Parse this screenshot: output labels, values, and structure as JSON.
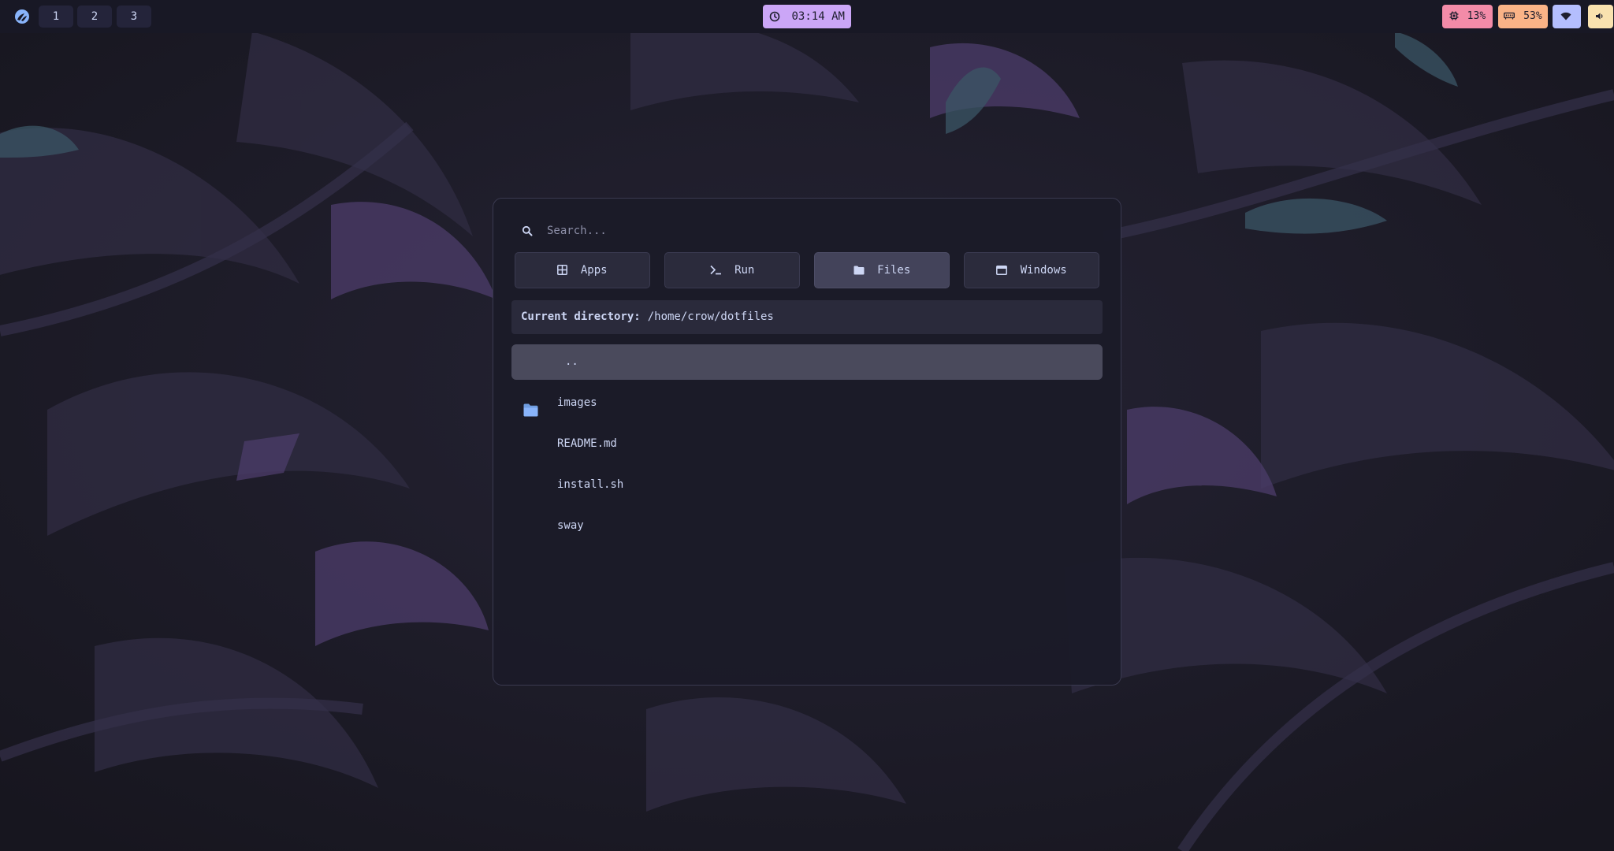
{
  "topbar": {
    "workspaces": [
      "1",
      "2",
      "3"
    ],
    "clock": "03:14 AM",
    "cpu": "13%",
    "memory": "53%",
    "icons": {
      "logo": "arch-logo-icon",
      "clock": "clock-icon",
      "cpu": "cpu-chip-icon",
      "memory": "memory-icon",
      "wifi": "wifi-icon",
      "volume": "volume-icon"
    }
  },
  "launcher": {
    "search": {
      "placeholder": "Search..."
    },
    "tabs": [
      {
        "label": "Apps",
        "icon": "grid-icon",
        "active": false
      },
      {
        "label": "Run",
        "icon": "terminal-icon",
        "active": false
      },
      {
        "label": "Files",
        "icon": "folder-icon",
        "active": true
      },
      {
        "label": "Windows",
        "icon": "window-icon",
        "active": false
      }
    ],
    "current_directory": {
      "label": "Current directory:",
      "path": "/home/crow/dotfiles"
    },
    "entries": [
      {
        "name": "..",
        "type": "parent",
        "selected": true
      },
      {
        "name": "images",
        "type": "folder",
        "selected": false
      },
      {
        "name": "README.md",
        "type": "file",
        "selected": false
      },
      {
        "name": "install.sh",
        "type": "file",
        "selected": false
      },
      {
        "name": "sway",
        "type": "file",
        "selected": false
      }
    ]
  },
  "colors": {
    "bar_bg": "#181825",
    "clock": "#cba6f7",
    "cpu": "#f38ba8",
    "memory": "#fab387",
    "wifi": "#b4befe",
    "volume": "#f9e2af",
    "folder": "#89b4fa"
  }
}
